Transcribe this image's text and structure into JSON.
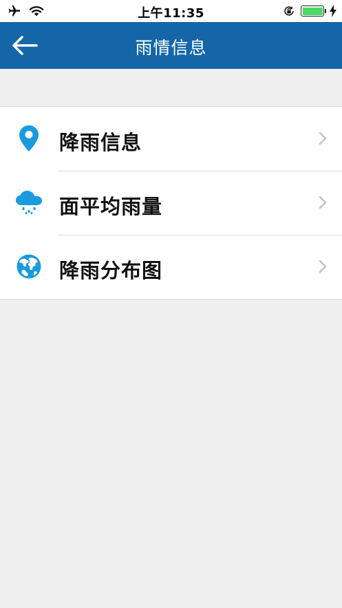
{
  "status_bar": {
    "time": "上午11:35",
    "icons": [
      "airplane-icon",
      "wifi-icon",
      "rotation-lock-icon",
      "battery-icon",
      "charging-bolt-icon"
    ],
    "battery_color": "#4cd964"
  },
  "nav": {
    "title": "雨情信息",
    "back_icon": "arrow-left-icon",
    "background": "#1466a9"
  },
  "menu": {
    "items": [
      {
        "label": "降雨信息",
        "icon": "map-pin-icon"
      },
      {
        "label": "面平均雨量",
        "icon": "rain-cloud-icon"
      },
      {
        "label": "降雨分布图",
        "icon": "globe-icon"
      }
    ],
    "accent_color": "#1a9be0"
  }
}
